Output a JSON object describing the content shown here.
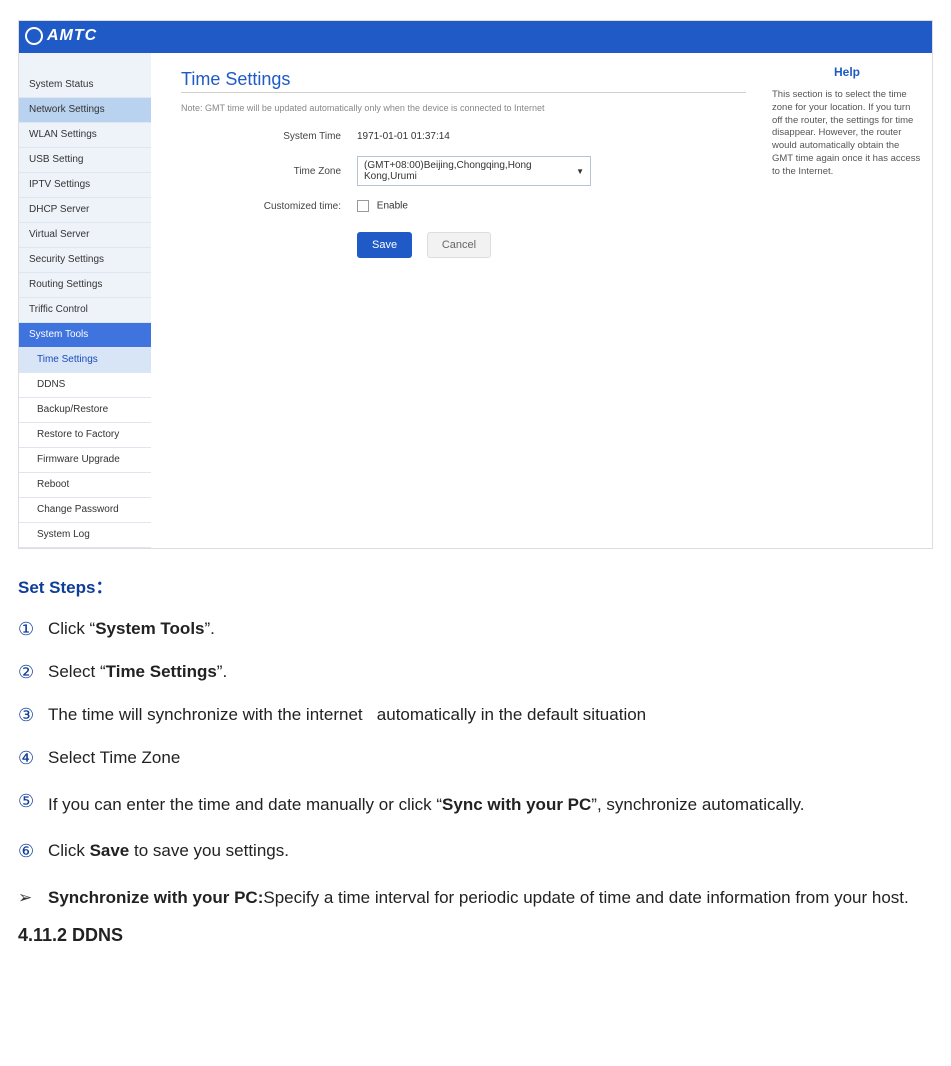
{
  "logo_text": "AMTC",
  "sidebar": {
    "items": [
      {
        "label": "System Status"
      },
      {
        "label": "Network Settings"
      },
      {
        "label": "WLAN Settings"
      },
      {
        "label": "USB Setting"
      },
      {
        "label": "IPTV Settings"
      },
      {
        "label": "DHCP Server"
      },
      {
        "label": "Virtual Server"
      },
      {
        "label": "Security Settings"
      },
      {
        "label": "Routing Settings"
      },
      {
        "label": "Triffic Control"
      },
      {
        "label": "System Tools"
      }
    ],
    "subs": [
      {
        "label": "Time Settings"
      },
      {
        "label": "DDNS"
      },
      {
        "label": "Backup/Restore"
      },
      {
        "label": "Restore to Factory"
      },
      {
        "label": "Firmware Upgrade"
      },
      {
        "label": "Reboot"
      },
      {
        "label": "Change Password"
      },
      {
        "label": "System Log"
      }
    ]
  },
  "panel": {
    "title": "Time Settings",
    "note": "Note: GMT time will be updated automatically only when the device is connected to Internet",
    "system_time_label": "System Time",
    "system_time_value": "1971-01-01 01:37:14",
    "time_zone_label": "Time Zone",
    "time_zone_value": "(GMT+08:00)Beijing,Chongqing,Hong Kong,Urumi",
    "customized_label": "Customized time:",
    "enable_label": "Enable",
    "save": "Save",
    "cancel": "Cancel"
  },
  "help": {
    "title": "Help",
    "text": "This section is to select the time zone for your location. If you turn off the router, the settings for time disappear. However, the router would automatically obtain the GMT time again once it has access to the Internet."
  },
  "doc": {
    "set_steps_title": "Set Steps：",
    "steps_num": [
      "①",
      "②",
      "③",
      "④",
      "⑤",
      "⑥"
    ],
    "step1_a": "Click “",
    "step1_b": "System Tools",
    "step1_c": "”.",
    "step2_a": "Select “",
    "step2_b": "Time Settings",
    "step2_c": "”.",
    "step3": "The time will synchronize with the internet   automatically in the default situation",
    "step4": "Select Time Zone",
    "step5_a": "If you can enter the time and date manually or click “",
    "step5_b": "Sync with your PC",
    "step5_c": "”, synchronize automatically.",
    "step6_a": "Click ",
    "step6_b": "Save",
    "step6_c": " to save you settings.",
    "bullet_tri": "➢",
    "bullet_a": "Synchronize with your PC:",
    "bullet_b": "Specify a time interval for periodic update of time and date information from your host.",
    "section": "4.11.2 DDNS"
  }
}
